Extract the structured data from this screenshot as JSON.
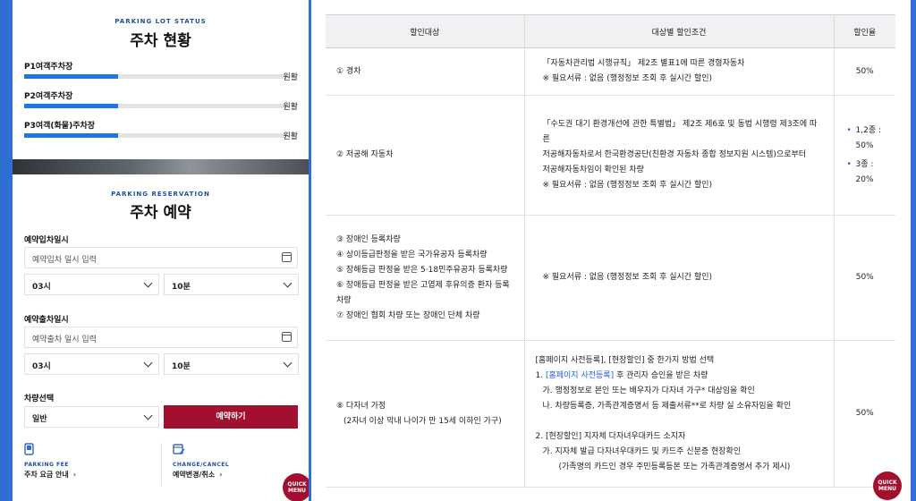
{
  "status": {
    "eyebrow": "PARKING LOT STATUS",
    "title": "주차 현황",
    "lots": [
      {
        "name": "P1여객주차장",
        "state": "원활",
        "fill": 0.36
      },
      {
        "name": "P2여객주차장",
        "state": "원활",
        "fill": 0.36
      },
      {
        "name": "P3여객(화물)주차장",
        "state": "원활",
        "fill": 0.36
      }
    ]
  },
  "reservation": {
    "eyebrow": "PARKING RESERVATION",
    "title": "주차 예약",
    "entry_label": "예약입차일시",
    "entry_placeholder": "예약입차 일시 입력",
    "entry_hour": "03시",
    "entry_min": "10분",
    "exit_label": "예약출차일시",
    "exit_placeholder": "예약출차 일시 입력",
    "exit_hour": "03시",
    "exit_min": "10분",
    "vehicle_label": "차량선택",
    "vehicle_value": "일반",
    "submit": "예약하기"
  },
  "quick_links": {
    "fee_label": "PARKING FEE",
    "fee_text": "주차 요금 안내",
    "change_label": "CHANGE/CANCEL",
    "change_text": "예약변경/취소",
    "arrow": "›"
  },
  "quick_menu": {
    "line1": "QUICK",
    "line2": "MENU"
  },
  "table": {
    "headers": [
      "할인대상",
      "대상별 할인조건",
      "할인율"
    ],
    "rows": [
      {
        "target": [
          "① 경차"
        ],
        "conditions": [
          "「자동차관리법 시행규칙」 제2조 별표1에 따른 경형자동차",
          "※ 필요서류 : 없음 (행정정보 조회 후 실시간 할인)"
        ],
        "rate": "50%"
      },
      {
        "target": [
          "② 저공해 자동차"
        ],
        "conditions": [
          "「수도권 대기 환경개선에 관한 특별법」 제2조 제6호 및 동법 시행령 제3조에 따른",
          "저공해자동차로서 한국환경공단(친환경 자동차 종합 정보지원 시스템)으로부터",
          "저공해자동차임이 확인된 차량",
          "※ 필요서류 : 없음 (행정정보 조회 후 실시간 할인)"
        ],
        "rates": [
          "1,2종 : 50%",
          "3종 : 20%"
        ]
      },
      {
        "target": [
          "③ 장애인 등록차량",
          "④ 상이등급판정을 받은 국가유공자 등록차량",
          "⑤ 장해등급 판정을 받은 5·18민주유공자 등록차량",
          "⑥ 장애등급 판정을 받은 고엽제 후유의증 환자 등록차량",
          "⑦ 장애인 협회 차량 또는 장애인 단체 차량"
        ],
        "conditions": [
          "※ 필요서류 : 없음 (행정정보 조회 후 실시간 할인)"
        ],
        "rate": "50%"
      },
      {
        "target": [
          "⑧ 다자녀 가정",
          "(2자녀 이상 막내 나이가 만 15세 이하인 가구)"
        ],
        "cond_intro": "[홈페이지 사전등록], [현장할인] 중 한가지 방법 선택",
        "cond_1_prefix": "1. ",
        "cond_1_link": "[홈페이지 사전등록]",
        "cond_1_suffix": " 후 관리자 승인을 받은 차량",
        "cond_1_a": "가. 행정정보로 본인 또는 배우자가 다자녀 가구* 대상임을 확인",
        "cond_1_b": "나. 차량등록증, 가족관계증명서 등 제출서류**로 차량 실 소유자임을 확인",
        "cond_2": "2. [현장할인] 지자체 다자녀우대카드 소지자",
        "cond_2_a": "가. 지자체 발급 다자녀우대카드 및 카드주 신분증 현장확인",
        "cond_2_note": "(가족명의 카드인 경우 주민등록등본 또는 가족관계증명서 추가 제시)",
        "rate": "50%"
      }
    ]
  },
  "colors": {
    "accent": "#a3102f",
    "bar": "#1f74e6",
    "background": "#2f6fd1"
  }
}
